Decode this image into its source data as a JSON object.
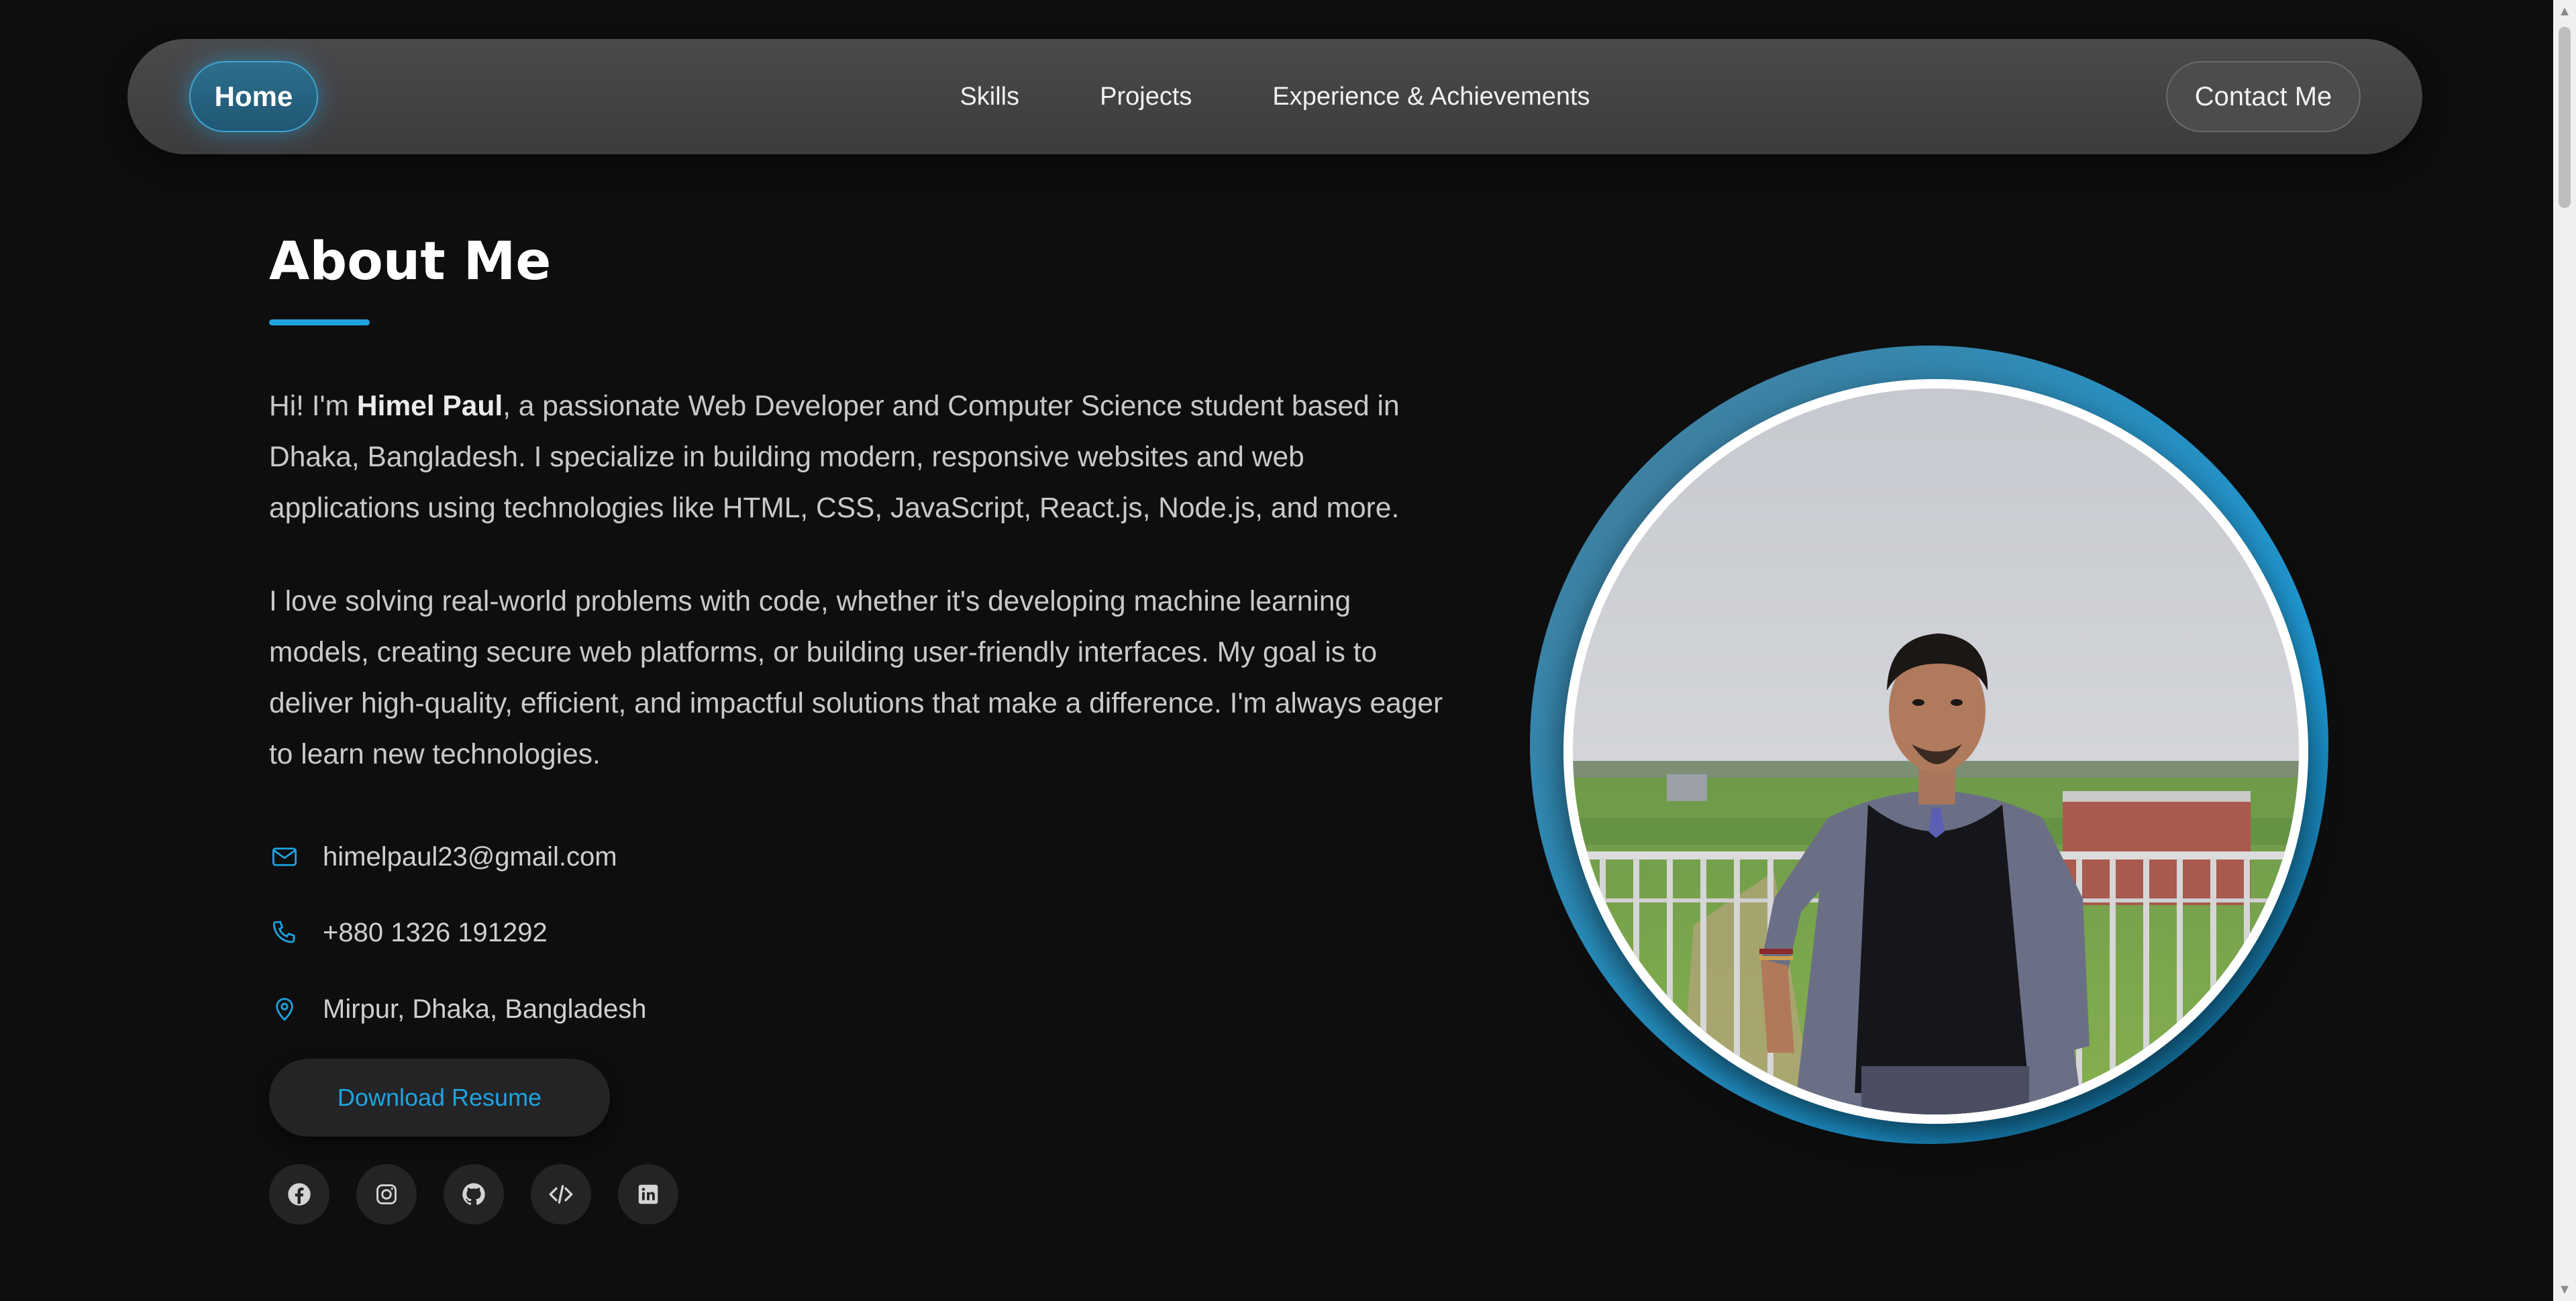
{
  "nav": {
    "home": "Home",
    "links": [
      "Skills",
      "Projects",
      "Experience & Achievements"
    ],
    "contact": "Contact Me"
  },
  "about": {
    "title": "About Me",
    "intro_greeting": "Hi! I'm ",
    "name": "Himel Paul",
    "intro_rest": ", a passionate Web Developer and Computer Science student based in Dhaka, Bangladesh. I specialize in building modern, responsive websites and web applications using technologies like HTML, CSS, JavaScript, React.js, Node.js, and more.",
    "paragraph2": "I love solving real-world problems with code, whether it's developing machine learning models, creating secure web platforms, or building user-friendly interfaces. My goal is to deliver high-quality, efficient, and impactful solutions that make a difference. I'm always eager to learn new technologies."
  },
  "contact": {
    "email": "himelpaul23@gmail.com",
    "phone": "+880 1326 191292",
    "location": "Mirpur, Dhaka, Bangladesh"
  },
  "resume_button": "Download Resume",
  "socials": [
    "facebook-icon",
    "instagram-icon",
    "github-icon",
    "code-icon",
    "linkedin-icon"
  ],
  "colors": {
    "accent": "#1fa3e0",
    "background": "#0e0e0f",
    "navbar": "#434345"
  }
}
